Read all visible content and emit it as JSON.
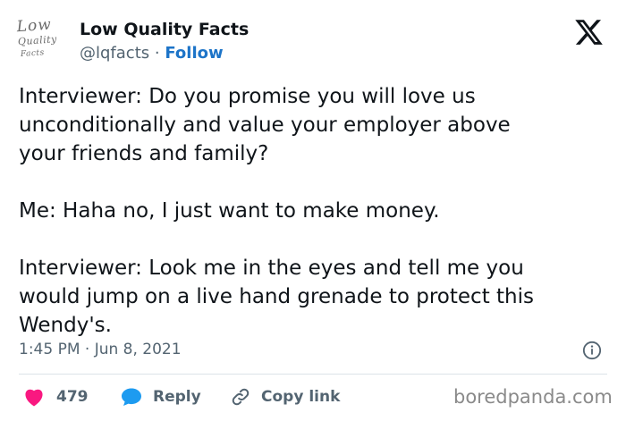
{
  "author": {
    "logo_text": [
      "Low",
      "Quality",
      "Facts"
    ],
    "name": "Low Quality Facts",
    "handle": "@lqfacts",
    "separator": "·",
    "follow_label": "Follow"
  },
  "platform_icon": "x-logo-icon",
  "tweet": {
    "paragraphs": [
      "Interviewer: Do you promise you will love us\nunconditionally and value your employer above\nyour friends and family?",
      "Me: Haha no, I just want to make money.",
      "Interviewer: Look me in the eyes and tell me you\nwould jump on a live hand grenade to protect this\nWendy's."
    ]
  },
  "meta": {
    "timestamp": "1:45 PM · Jun 8, 2021",
    "info_icon": "info-icon"
  },
  "actions": {
    "like_count": "479",
    "reply_label": "Reply",
    "copy_label": "Copy link"
  },
  "colors": {
    "heart": "#f91880",
    "reply_bubble": "#1d9bf0",
    "follow": "#1d74c8",
    "muted": "#536471"
  },
  "watermark": "boredpanda.com"
}
